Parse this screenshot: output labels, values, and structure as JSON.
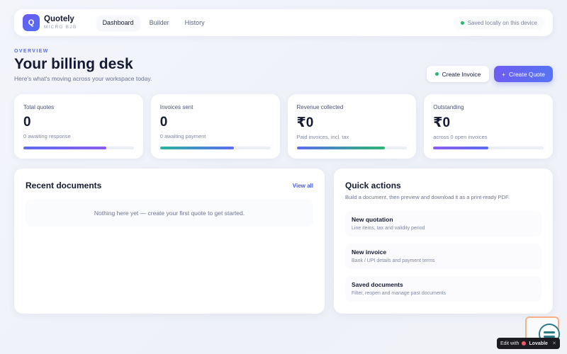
{
  "app": {
    "logo_letter": "Q",
    "name": "Quotely",
    "subtitle": "MICRO B2B"
  },
  "nav": {
    "tabs": [
      {
        "label": "Dashboard",
        "active": true
      },
      {
        "label": "Builder",
        "active": false
      },
      {
        "label": "History",
        "active": false
      }
    ]
  },
  "status": {
    "saved_text": "Saved locally on this device",
    "color": "#2bb673"
  },
  "header": {
    "overline": "OVERVIEW",
    "title": "Your billing desk",
    "subtitle": "Here's what's moving across your workspace today."
  },
  "actions": {
    "create_invoice": "Create Invoice",
    "create_quote": "Create Quote",
    "plus_icon": "+"
  },
  "stats": [
    {
      "label": "Total quotes",
      "value": "0",
      "sub": "0 awaiting response",
      "progress": 0.75,
      "color_from": "#5b6cf0",
      "color_to": "#8a5cf0"
    },
    {
      "label": "Invoices sent",
      "value": "0",
      "sub": "0 awaiting payment",
      "progress": 0.67,
      "color_from": "#2bb3a0",
      "color_to": "#5b6cf0"
    },
    {
      "label": "Revenue collected",
      "value": "₹0",
      "sub": "Paid invoices, incl. tax",
      "progress": 0.8,
      "color_from": "#5b6cf0",
      "color_to": "#2bb673"
    },
    {
      "label": "Outstanding",
      "value": "₹0",
      "sub": "across 0 open invoices",
      "progress": 0.5,
      "color_from": "#8a5cf0",
      "color_to": "#5b6cf0"
    }
  ],
  "recent": {
    "title": "Recent documents",
    "view_all": "View all",
    "empty_text": "Nothing here yet — create your first quote to get started."
  },
  "quick": {
    "title": "Quick actions",
    "subtitle": "Build a document, then preview and download it as a print-ready PDF.",
    "items": [
      {
        "title": "New quotation",
        "sub": "Line items, tax and validity period"
      },
      {
        "title": "New invoice",
        "sub": "Bank / UPI details and payment terms"
      },
      {
        "title": "Saved documents",
        "sub": "Filter, reopen and manage past documents"
      }
    ]
  },
  "badge": {
    "edit_with": "Edit with",
    "brand": "Lovable",
    "close": "✕"
  }
}
